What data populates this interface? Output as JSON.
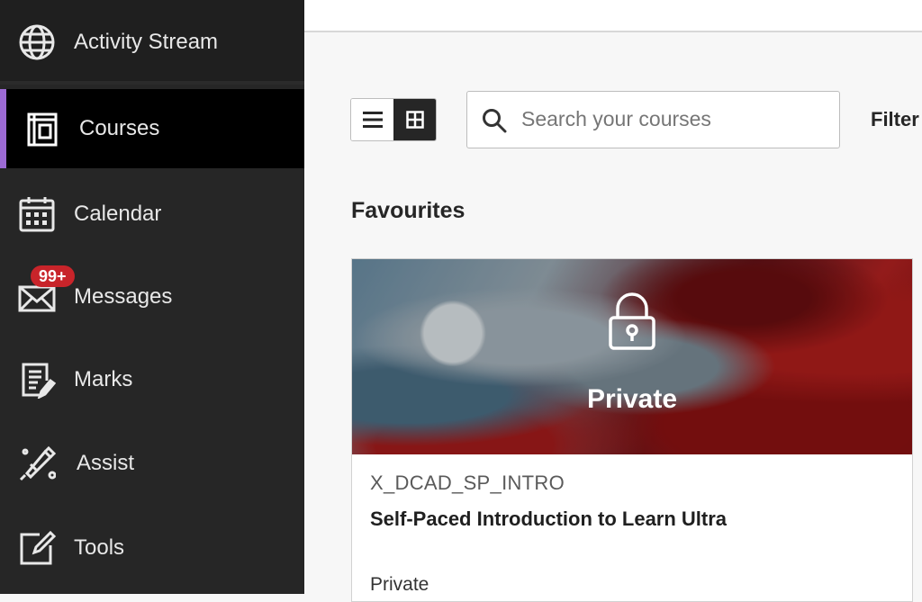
{
  "sidebar": {
    "items": [
      {
        "label": "Activity Stream",
        "icon": "globe-icon"
      },
      {
        "label": "Courses",
        "icon": "courses-icon"
      },
      {
        "label": "Calendar",
        "icon": "calendar-icon"
      },
      {
        "label": "Messages",
        "icon": "envelope-icon",
        "badge": "99+"
      },
      {
        "label": "Marks",
        "icon": "marks-icon"
      },
      {
        "label": "Assist",
        "icon": "assist-icon"
      },
      {
        "label": "Tools",
        "icon": "tools-icon"
      }
    ],
    "active_item": "Courses",
    "accent_color": "#9c6ad4",
    "badge_color": "#c8242a"
  },
  "toolbar": {
    "view_modes": [
      "list",
      "grid"
    ],
    "active_view": "grid",
    "search_placeholder": "Search your courses",
    "filter_label": "Filter"
  },
  "main": {
    "section_title": "Favourites",
    "courses": [
      {
        "image_label": "Private",
        "code": "X_DCAD_SP_INTRO",
        "title": "Self-Paced Introduction to Learn Ultra",
        "status": "Private"
      }
    ]
  }
}
